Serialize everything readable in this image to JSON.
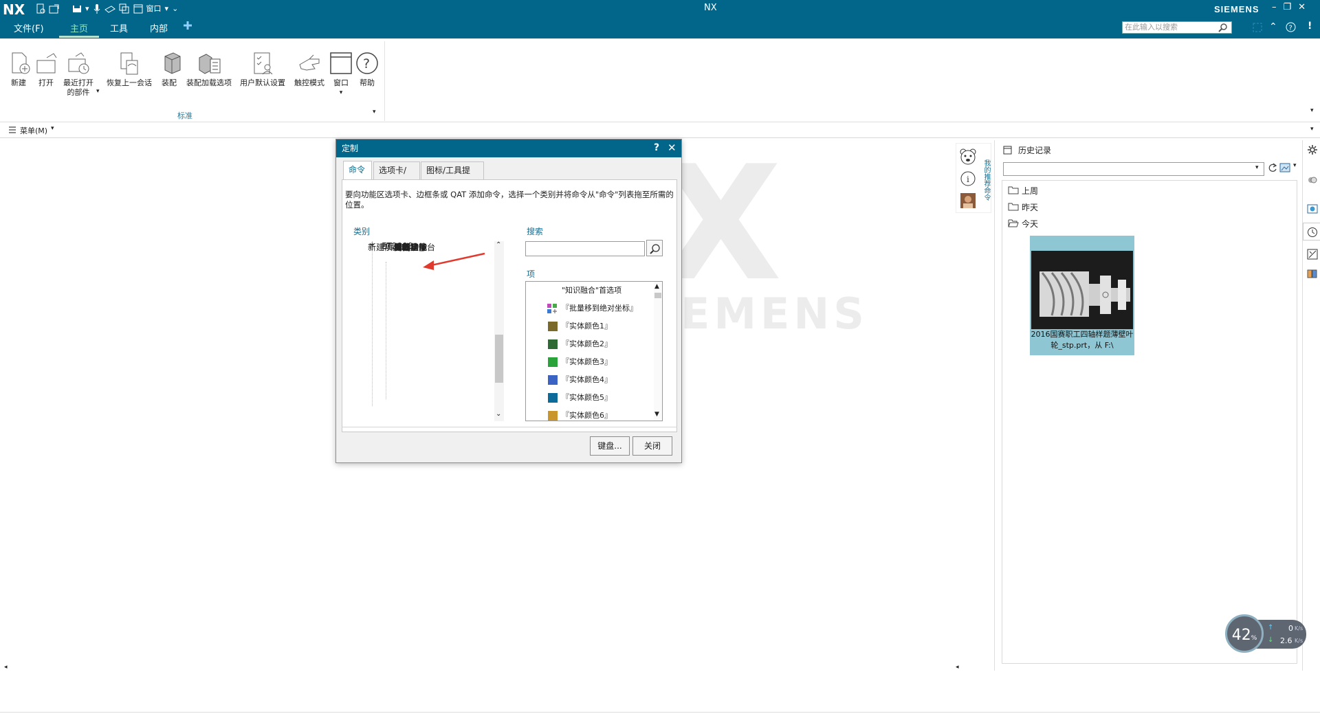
{
  "app": {
    "logo": "NX",
    "window_title": "NX",
    "brand": "SIEMENS",
    "qat_window_label": "窗口"
  },
  "menu": {
    "file": "文件(F)",
    "home": "主页",
    "tools": "工具",
    "internal": "内部"
  },
  "search": {
    "placeholder": "在此输入以搜索"
  },
  "ribbon": {
    "buttons": {
      "new": "新建",
      "open": "打开",
      "recent_1": "最近打开",
      "recent_2": "的部件",
      "restore": "恢复上一会话",
      "assembly": "装配",
      "assembly_load": "装配加载选项",
      "user_defaults": "用户默认设置",
      "touch": "触控模式",
      "window": "窗口",
      "help": "帮助"
    },
    "group_label": "标准",
    "menu_button": "菜单(M)"
  },
  "watermark": {
    "x": "X",
    "siemens": "EMENS"
  },
  "dialog": {
    "title": "定制",
    "tabs": [
      "命令",
      "选项卡/条",
      "图标/工具提示"
    ],
    "instruction": "要向功能区选项卡、边框条或 QAT 添加命令，选择一个类别并将命令从\"命令\"列表拖至所需的位置。",
    "category_label": "类别",
    "search_label": "搜索",
    "items_label": "项",
    "categories": [
      {
        "label": "帮助(H)",
        "expander": "+"
      },
      {
        "label": "ET2008",
        "expander": "−"
      },
      {
        "label": "自动盒子"
      },
      {
        "label": "分析尺寸"
      },
      {
        "label": "电极基准台"
      },
      {
        "label": "实体功能"
      },
      {
        "label": "面线功能"
      },
      {
        "label": "实体定位"
      },
      {
        "label": "分割物体"
      },
      {
        "label": "加工功能"
      },
      {
        "label": "制图功能"
      },
      {
        "label": "其他功能"
      },
      {
        "label": "新建项"
      }
    ],
    "items": [
      {
        "label": "\"知识融合\"首选项",
        "color": ""
      },
      {
        "label": "『批量移到绝对坐标』",
        "color": ""
      },
      {
        "label": "『实体颜色1』",
        "color": "#7a6a2a"
      },
      {
        "label": "『实体颜色2』",
        "color": "#2e6b34"
      },
      {
        "label": "『实体颜色3』",
        "color": "#2aa33a"
      },
      {
        "label": "『实体颜色4』",
        "color": "#3a63c4"
      },
      {
        "label": "『实体颜色5』",
        "color": "#0d6b9a"
      },
      {
        "label": "『实体颜色6』",
        "color": "#c8962a"
      }
    ],
    "keyboard_button": "键盘...",
    "close_button": "关闭"
  },
  "resource_bar": {
    "vertical_label": "我的推荐命令"
  },
  "history": {
    "title": "历史记录",
    "folders": [
      "上周",
      "昨天",
      "今天"
    ],
    "thumbnail_caption": "2016国赛职工四轴样题薄壁叶轮_stp.prt，从 F:\\"
  },
  "net_widget": {
    "percent": "42",
    "percent_unit": "%",
    "up": "0",
    "down": "2.6",
    "unit": "K/s"
  },
  "colors": {
    "title_bar": "#02658a",
    "accent": "#1a6e90",
    "thumb_bg": "#8ec6d3"
  }
}
